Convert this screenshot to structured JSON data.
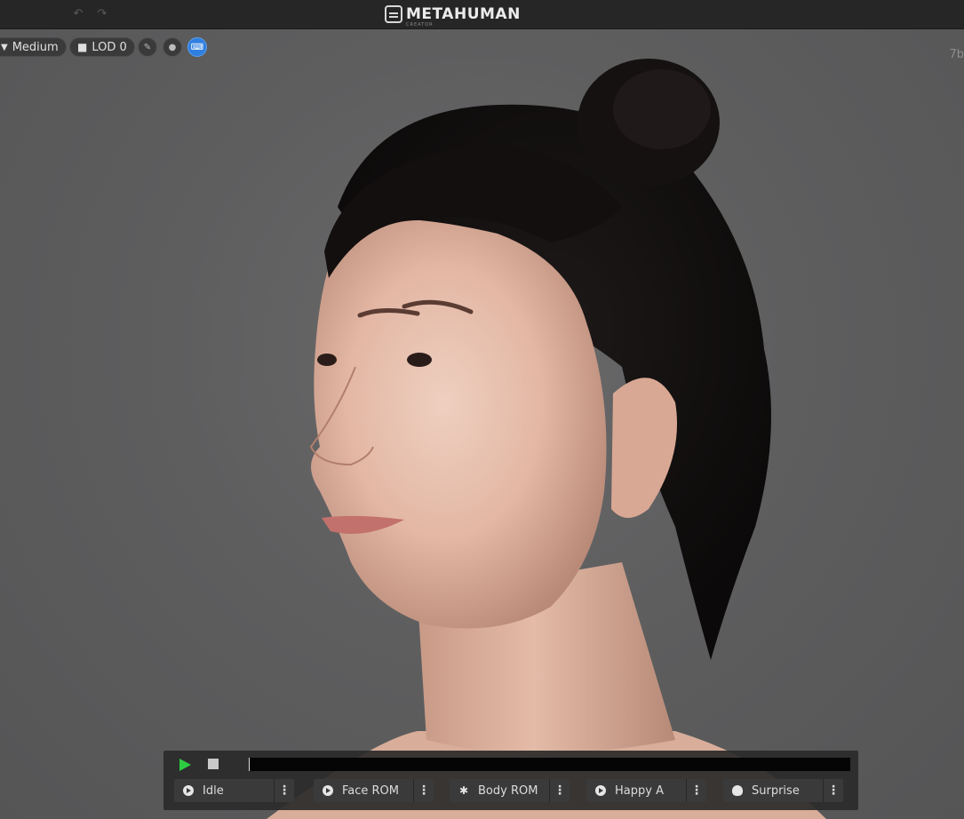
{
  "app": {
    "title": "METAHUMAN",
    "subtitle": "CREATOR"
  },
  "toolbar": {
    "undo_icon": "undo-icon",
    "redo_icon": "redo-icon",
    "quality_label": "Medium",
    "lod_label": "LOD 0",
    "buttons": [
      "pose-icon",
      "sphere-icon",
      "keyboard-icon"
    ],
    "corner_text": "7b"
  },
  "playback": {
    "play_icon": "play-icon",
    "stop_icon": "stop-icon",
    "progress": 0.0,
    "animations": [
      {
        "label": "Idle",
        "icon": "play-circle-icon"
      },
      {
        "label": "Face ROM",
        "icon": "play-circle-icon"
      },
      {
        "label": "Body ROM",
        "icon": "running-person-icon"
      },
      {
        "label": "Happy A",
        "icon": "play-circle-icon"
      },
      {
        "label": "Surprise",
        "icon": "skull-icon"
      }
    ]
  },
  "colors": {
    "accent_blue": "#2f7fe0",
    "play_green": "#2ecc40",
    "background": "#5d5d5e"
  }
}
